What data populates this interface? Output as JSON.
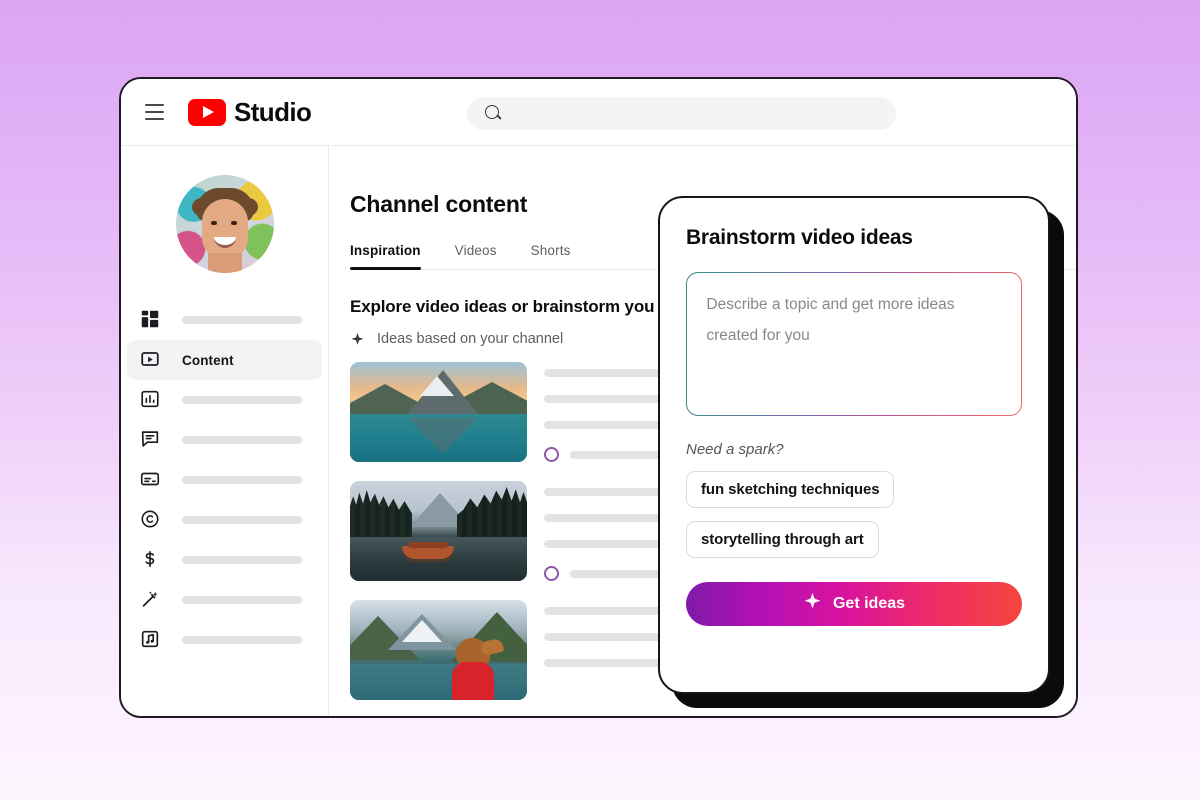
{
  "background": {
    "gradient_from": "#dba5f4",
    "gradient_to": "#fdf6fe"
  },
  "browser": {
    "topbar": {
      "menu_icon": "hamburger-menu-icon",
      "logo_icon": "youtube-play-icon",
      "brand": "Studio",
      "brand_color": "#ff0000",
      "search": {
        "icon": "search-icon",
        "value": "",
        "placeholder": ""
      }
    },
    "sidebar": {
      "avatar_alt": "channel-avatar",
      "items": [
        {
          "icon": "dashboard-grid-icon",
          "label": "",
          "active": false
        },
        {
          "icon": "content-video-icon",
          "label": "Content",
          "active": true
        },
        {
          "icon": "analytics-bar-chart-icon",
          "label": "",
          "active": false
        },
        {
          "icon": "comments-speech-bubble-icon",
          "label": "",
          "active": false
        },
        {
          "icon": "subtitles-icon",
          "label": "",
          "active": false
        },
        {
          "icon": "copyright-icon",
          "label": "",
          "active": false
        },
        {
          "icon": "earn-dollar-icon",
          "label": "",
          "active": false
        },
        {
          "icon": "customization-magic-wand-icon",
          "label": "",
          "active": false
        },
        {
          "icon": "audio-library-music-icon",
          "label": "",
          "active": false
        }
      ]
    },
    "main": {
      "page_title": "Channel content",
      "tabs": [
        {
          "label": "Inspiration",
          "active": true
        },
        {
          "label": "Videos",
          "active": false
        },
        {
          "label": "Shorts",
          "active": false
        }
      ],
      "explore_heading": "Explore video ideas or brainstorm you",
      "ideas_subheading": {
        "icon": "sparkle-icon",
        "label": "Ideas based on your channel"
      },
      "idea_rows": [
        {
          "thumbnail": "mountain-lake-reflection-thumbnail",
          "status_icon": "loading-ring-icon"
        },
        {
          "thumbnail": "forest-lake-canoe-thumbnail",
          "status_icon": "loading-ring-icon"
        },
        {
          "thumbnail": "red-jacket-hiker-lake-thumbnail",
          "status_icon": "loading-ring-icon"
        }
      ]
    }
  },
  "dialog": {
    "title": "Brainstorm video ideas",
    "prompt": {
      "value": "",
      "placeholder": "Describe a topic and get more ideas created for you",
      "border_gradient": [
        "#2d8f7e",
        "#7b63b0",
        "#c8558a",
        "#ee6a63"
      ]
    },
    "spark_label": "Need a spark?",
    "suggestion_chips": [
      "fun sketching techniques",
      "storytelling through art"
    ],
    "submit": {
      "label": "Get ideas",
      "icon": "sparkle-icon",
      "gradient_from": "#8019a8",
      "gradient_to": "#f6453f"
    }
  }
}
